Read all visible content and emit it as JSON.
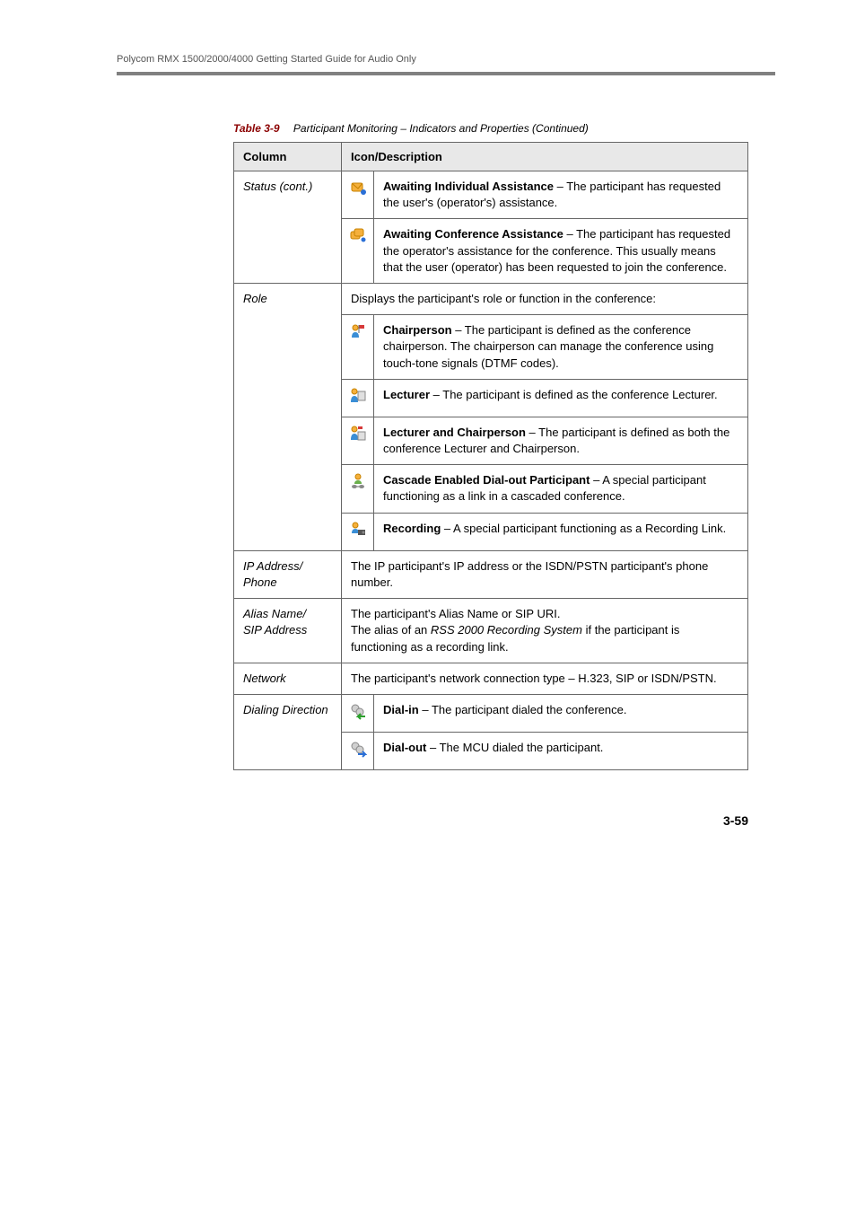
{
  "header": "Polycom RMX 1500/2000/4000 Getting Started Guide for Audio Only",
  "table": {
    "label": "Table 3-9",
    "title": "Participant Monitoring – Indicators and Properties (Continued)",
    "columns": {
      "col1": "Column",
      "col2": "Icon/Description"
    },
    "status_cont": {
      "label": "Status (cont.)",
      "r1": {
        "icon": "await-individual-icon",
        "bold": "Awaiting Individual Assistance",
        "text": " – The participant has requested the user's (operator's) assistance."
      },
      "r2": {
        "icon": "await-conference-icon",
        "bold": "Awaiting Conference Assistance",
        "text": " – The participant has requested the operator's assistance for the conference. This usually means that the user (operator) has been requested to join the conference."
      }
    },
    "role": {
      "label": "Role",
      "intro": "Displays the participant's role or function in the conference:",
      "r1": {
        "icon": "chairperson-icon",
        "bold": "Chairperson",
        "text": " – The participant is defined as the conference chairperson. The chairperson can manage the conference using touch-tone signals (DTMF codes)."
      },
      "r2": {
        "icon": "lecturer-icon",
        "bold": "Lecturer",
        "text": " – The participant is defined as the conference Lecturer."
      },
      "r3": {
        "icon": "lecturer-chairperson-icon",
        "bold": "Lecturer and Chairperson",
        "text": " – The participant is defined as both the conference Lecturer and Chairperson."
      },
      "r4": {
        "icon": "cascade-icon",
        "bold": "Cascade Enabled Dial-out Participant",
        "text": " – A special participant functioning as a link in a cascaded conference."
      },
      "r5": {
        "icon": "recording-icon",
        "bold": "Recording",
        "text": " – A special participant functioning as a Recording Link."
      }
    },
    "ip_phone": {
      "label": "IP Address/\nPhone",
      "text": "The IP participant's IP address or the ISDN/PSTN participant's phone number."
    },
    "alias": {
      "label": "Alias Name/\nSIP Address",
      "text_pre": "The participant's Alias Name or SIP URI.\nThe alias of an ",
      "text_italic": "RSS 2000 Recording System",
      "text_post": " if the participant is functioning as a recording link."
    },
    "network": {
      "label": "Network",
      "text": "The participant's network connection type – H.323, SIP or ISDN/PSTN."
    },
    "dialing": {
      "label": "Dialing Direction",
      "r1": {
        "icon": "dial-in-icon",
        "bold": "Dial-in",
        "text": " – The participant dialed the conference."
      },
      "r2": {
        "icon": "dial-out-icon",
        "bold": "Dial-out",
        "text": " – The MCU dialed the participant."
      }
    }
  },
  "page_number": "3-59"
}
